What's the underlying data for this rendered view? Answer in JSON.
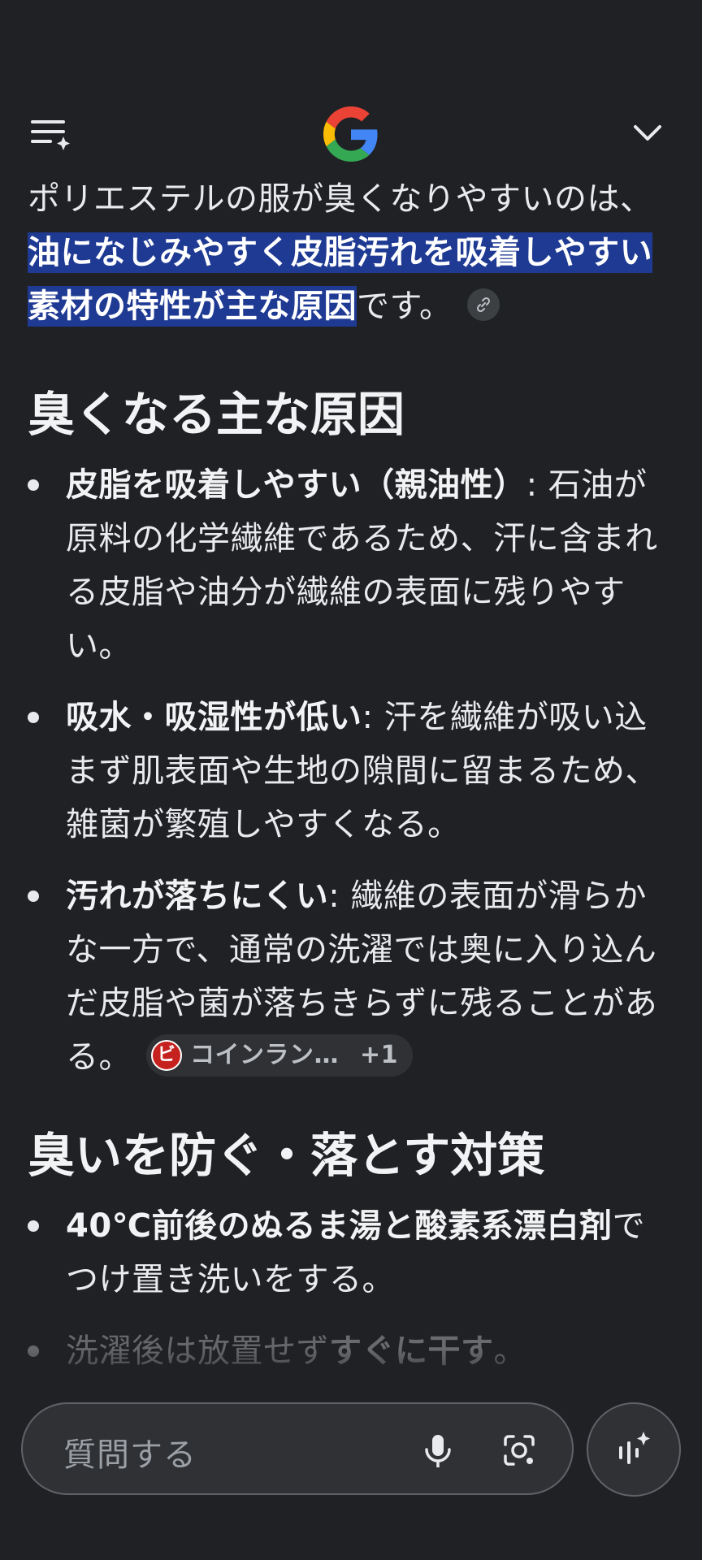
{
  "header": {
    "menu_icon": "menu-sparkle-icon",
    "logo": "google-g-logo",
    "collapse_icon": "chevron-down-icon"
  },
  "answer": {
    "intro_prefix": "ポリエステルの服が臭くなりやすいのは、",
    "intro_highlight": "油になじみやすく皮脂汚れを吸着しやすい素材の特性が主な原因",
    "intro_suffix": "です。",
    "section1_title": "臭くなる主な原因",
    "causes": [
      {
        "bold": "皮脂を吸着しやすい（親油性）",
        "text": ": 石油が原料の化学繊維であるため、汗に含まれる皮脂や油分が繊維の表面に残りやすい。"
      },
      {
        "bold": "吸水・吸湿性が低い",
        "text": ": 汗を繊維が吸い込まず肌表面や生地の隙間に留まるため、雑菌が繁殖しやすくなる。"
      },
      {
        "bold": "汚れが落ちにくい",
        "text": ": 繊維の表面が滑らかな一方で、通常の洗濯では奥に入り込んだ皮脂や菌が落ちきらずに残ることがある。"
      }
    ],
    "source_chip": {
      "icon_letter": "ビ",
      "name": "コインラン…",
      "more": "+1"
    },
    "section2_title": "臭いを防ぐ・落とす対策",
    "measures": [
      {
        "bold": "40℃前後のぬるま湯と酸素系漂白剤",
        "text": "でつけ置き洗いをする。"
      },
      {
        "text_pre": "洗濯後は放置せず",
        "bold": "すぐに干す",
        "text": "。"
      }
    ]
  },
  "bottom": {
    "ask_placeholder": "質問する",
    "mic_icon": "mic-icon",
    "lens_icon": "lens-camera-icon",
    "voice_icon": "voice-sparkle-icon"
  }
}
